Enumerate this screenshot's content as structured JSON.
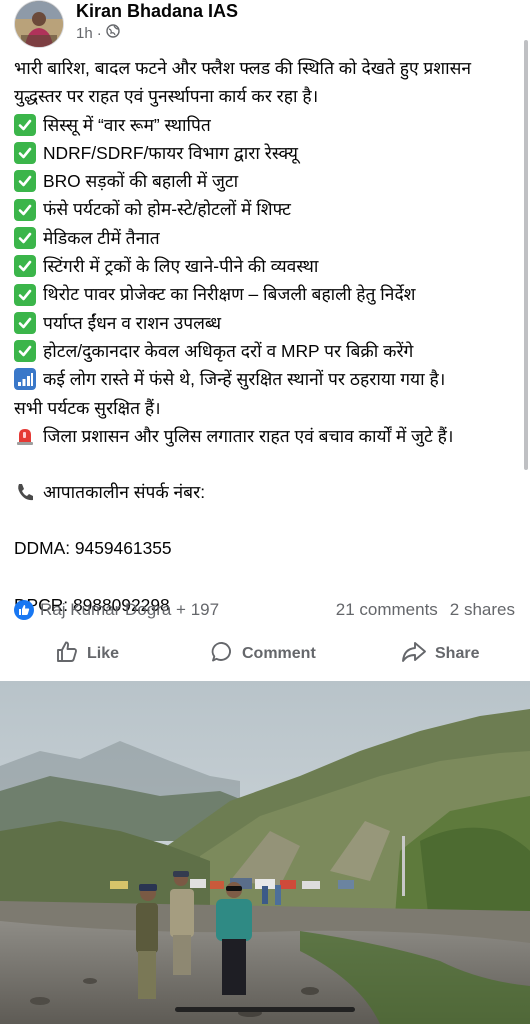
{
  "post": {
    "author": "Kiran Bhadana IAS",
    "time": "1h",
    "intro": [
      "भारी बारिश, बादल फटने और फ्लैश फ्लड की स्थिति को देखते हुए प्रशासन",
      "युद्धस्तर पर राहत एवं पुनर्स्थापना कार्य कर रहा है।"
    ],
    "checklist": [
      "सिस्सू में “वार रूम” स्थापित",
      "NDRF/SDRF/फायर विभाग द्वारा रेस्क्यू",
      "BRO सड़कों की बहाली में जुटा",
      "फंसे पर्यटकों को होम-स्टे/होटलों में शिफ्ट",
      "मेडिकल टीमें  तैनात",
      "स्टिंगरी में ट्रकों के लिए खाने-पीने की व्यवस्था",
      "थिरोट पावर प्रोजेक्ट का निरीक्षण – बिजली बहाली हेतु निर्देश",
      "पर्याप्त ईंधन व राशन उपलब्ध",
      "होटल/दुकानदार केवल अधिकृत दरों व MRP पर बिक्री करेंगे"
    ],
    "stranded_line1": "कई लोग रास्ते में फंसे थे, जिन्हें सुरक्षित स्थानों पर ठहराया गया है।",
    "stranded_line2": "सभी पर्यटक सुरक्षित हैं।",
    "police_line": "जिला प्रशासन और पुलिस लगातार राहत एवं बचाव कार्यों में जुटे हैं।",
    "emergency_header": "आपातकालीन संपर्क नंबर:",
    "ddma": "DDMA: 9459461355",
    "dpcr": "DPCR: 8988092298"
  },
  "reactions": {
    "reactors": "Raj Kumar Dogra + 197",
    "comments": "21 comments",
    "shares": "2 shares"
  },
  "actions": {
    "like": "Like",
    "comment": "Comment",
    "share": "Share"
  },
  "icons": {
    "check": "white-heavy-check-mark",
    "signal": "antenna-bars",
    "siren": "police-car-light",
    "phone": "telephone-receiver"
  },
  "colors": {
    "accent": "#1877f2",
    "check_green": "#3bb54a",
    "muted": "#65676b"
  }
}
